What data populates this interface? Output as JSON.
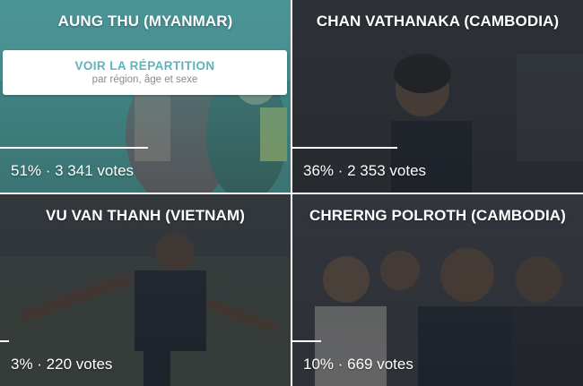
{
  "breakdown": {
    "title": "VOIR LA RÉPARTITION",
    "subtitle": "par région, âge et sexe"
  },
  "candidates": [
    {
      "name": "AUNG THU (MYANMAR)",
      "percent": 51,
      "stats": "51% · 3 341 votes"
    },
    {
      "name": "CHAN VATHANAKA (CAMBODIA)",
      "percent": 36,
      "stats": "36% · 2 353 votes"
    },
    {
      "name": "VU VAN THANH (VIETNAM)",
      "percent": 3,
      "stats": "3% · 220 votes"
    },
    {
      "name": "CHRERNG POLROTH (CAMBODIA)",
      "percent": 10,
      "stats": "10% · 669 votes"
    }
  ],
  "colors": {
    "highlight_overlay": "#46969b",
    "dark_overlay": "#282c32",
    "breakdown_accent": "#5cb4bb"
  }
}
